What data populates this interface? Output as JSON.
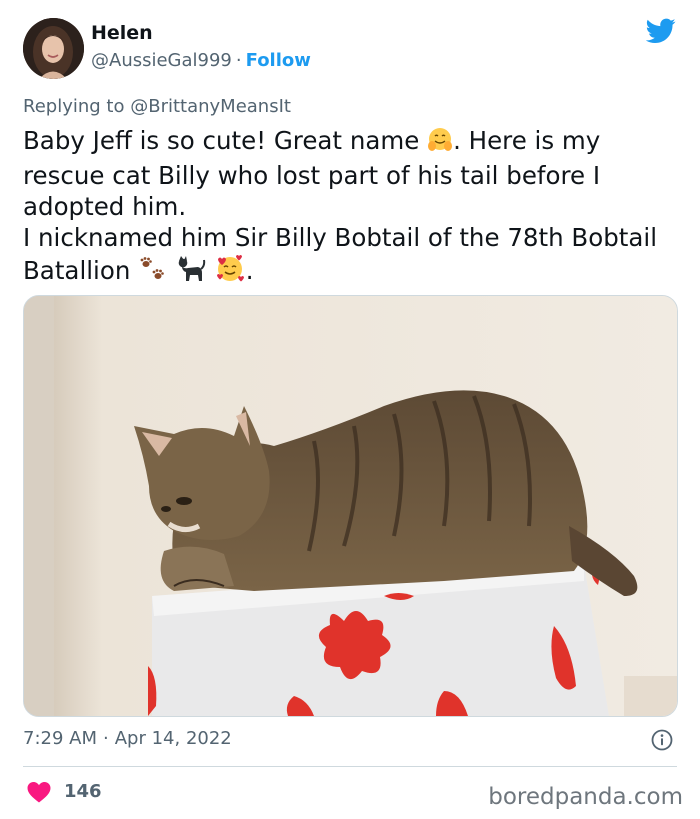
{
  "author": {
    "name": "Helen",
    "handle": "@AussieGal999",
    "separator": "·",
    "follow_label": "Follow",
    "avatar_icon": "user-avatar"
  },
  "brand": {
    "icon": "twitter-bird-icon",
    "color": "#1d9bf0"
  },
  "reply": {
    "prefix": "Replying to",
    "mention": "@BrittanyMeansIt"
  },
  "tweet": {
    "line1_a": "Baby Jeff is so cute! Great name",
    "line1_b": ". Here is my rescue cat Billy who lost part of his tail before I adopted him.",
    "line2": "I nicknamed him Sir Billy Bobtail of the 78th Bobtail Batallion",
    "line2_end": ".",
    "emojis": [
      "hugging-face",
      "paw-prints",
      "black-cat",
      "smiling-face-with-hearts"
    ]
  },
  "media": {
    "description_icon": "cat-photo"
  },
  "meta": {
    "time": "7:29 AM",
    "separator": "·",
    "date": "Apr 14, 2022",
    "info_icon": "info-icon"
  },
  "engagement": {
    "likes": "146",
    "heart_color": "#f91880"
  },
  "watermark": "boredpanda.com"
}
